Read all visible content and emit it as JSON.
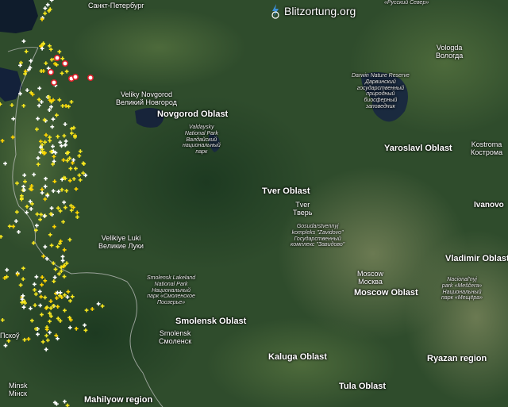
{
  "brand": {
    "name": "Blitzortung.org"
  },
  "regions": [
    {
      "id": "novgorod",
      "name": "Novgorod Oblast"
    },
    {
      "id": "yaroslavl",
      "name": "Yaroslavl Oblast"
    },
    {
      "id": "tver",
      "name": "Tver Oblast"
    },
    {
      "id": "vladimir",
      "name": "Vladimir Oblast"
    },
    {
      "id": "moscow",
      "name": "Moscow Oblast"
    },
    {
      "id": "smolensk",
      "name": "Smolensk Oblast"
    },
    {
      "id": "kaluga",
      "name": "Kaluga Oblast"
    },
    {
      "id": "ryazan",
      "name": "Ryazan region"
    },
    {
      "id": "tula",
      "name": "Tula Oblast"
    },
    {
      "id": "mahilyow",
      "name": "Mahilyow region"
    }
  ],
  "cities": [
    {
      "id": "spb",
      "name": "Санкт-Петербург"
    },
    {
      "id": "novgorod",
      "name": "Veliky Novgorod\nВеликий Новгород"
    },
    {
      "id": "vologda",
      "name": "Vologda\nВологда"
    },
    {
      "id": "kostroma",
      "name": "Kostroma\nКострома"
    },
    {
      "id": "ivanovo",
      "name": "Ivanovo"
    },
    {
      "id": "tver",
      "name": "Tver\nТверь"
    },
    {
      "id": "luki",
      "name": "Velikiye Luki\nВеликие Луки"
    },
    {
      "id": "moscow",
      "name": "Moscow\nМосква"
    },
    {
      "id": "smolensk",
      "name": "Smolensk\nСмоленск"
    },
    {
      "id": "minsk",
      "name": "Minsk\nМінск"
    },
    {
      "id": "pskov",
      "name": "Пскоў"
    }
  ],
  "parks": [
    {
      "id": "russky",
      "name": "«Русский Север»"
    },
    {
      "id": "darwin",
      "name": "Darwin Nature Reserve\nДарвинский\nгосударственный\nприродный\nбиосферный\nзаповедник"
    },
    {
      "id": "valdaysky",
      "name": "Valdaysky\nNational Park\nВалдайский\nнациональный\nпарк"
    },
    {
      "id": "zavidovo",
      "name": "Gosudarstvennyj\nkompleks \"Zavidovo\"\nГосударственный\nкомплекс \"Завидово\""
    },
    {
      "id": "smolensk-lakeland",
      "name": "Smolensk Lakeland\nNational Park\nНациональный\nпарк «Смоленское\nПоозерье»"
    },
    {
      "id": "meshchera",
      "name": "Nacional'nyj\npark «Meščera»\nНациональный\nпарк «Мещёра»"
    }
  ],
  "strikes": {
    "colors": {
      "recent": "#ffffff",
      "older": "#f5e61e",
      "oldest": "#ffd400",
      "circle": "#e0202a"
    }
  }
}
